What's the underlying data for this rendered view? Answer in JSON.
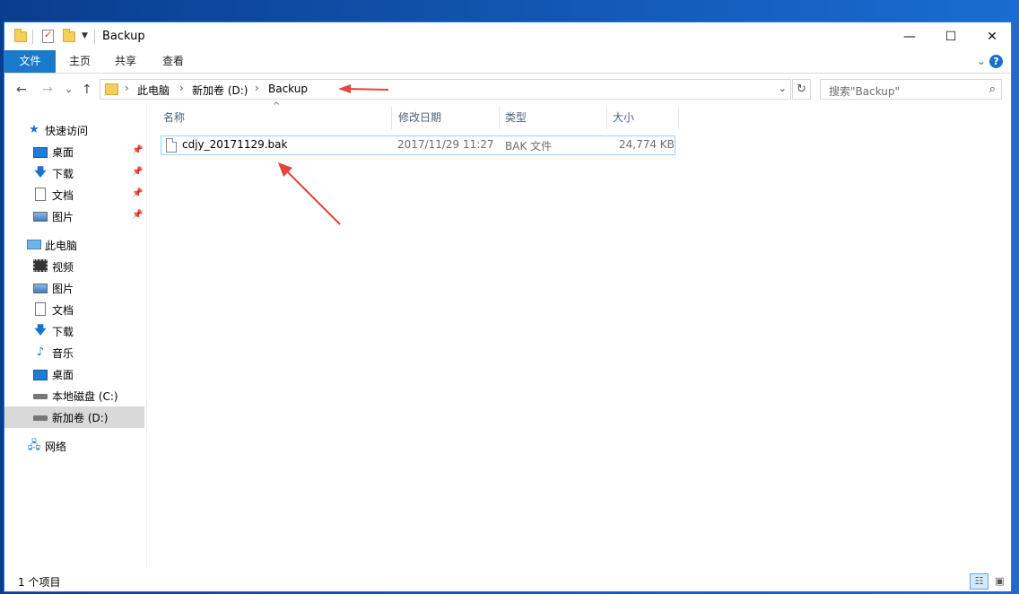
{
  "window": {
    "title": "Backup",
    "minimize_icon": "—",
    "maximize_icon": "☐",
    "close_icon": "✕"
  },
  "ribbon": {
    "tabs": [
      "文件",
      "主页",
      "共享",
      "查看"
    ],
    "collapse_icon": "⌄",
    "help_icon": "?"
  },
  "address": {
    "crumbs": [
      "此电脑",
      "新加卷 (D:)",
      "Backup"
    ],
    "separator": "›",
    "dropdown_icon": "⌄",
    "refresh_icon": "↻"
  },
  "nav": {
    "back": "←",
    "forward": "→",
    "recent": "⌄",
    "up": "↑"
  },
  "search": {
    "placeholder": "搜索\"Backup\"",
    "icon": "⌕"
  },
  "sidebar": {
    "quick_access": "快速访问",
    "quick_items": [
      {
        "label": "桌面",
        "icon": "desktop-icon"
      },
      {
        "label": "下载",
        "icon": "download-icon"
      },
      {
        "label": "文档",
        "icon": "document-icon"
      },
      {
        "label": "图片",
        "icon": "pictures-icon"
      }
    ],
    "pin_icon": "📌",
    "this_pc": "此电脑",
    "pc_items": [
      {
        "label": "视频",
        "icon": "videos-icon"
      },
      {
        "label": "图片",
        "icon": "pictures-icon"
      },
      {
        "label": "文档",
        "icon": "document-icon"
      },
      {
        "label": "下载",
        "icon": "download-icon"
      },
      {
        "label": "音乐",
        "icon": "music-icon"
      },
      {
        "label": "桌面",
        "icon": "desktop-icon"
      },
      {
        "label": "本地磁盘 (C:)",
        "icon": "drive-icon"
      },
      {
        "label": "新加卷 (D:)",
        "icon": "drive-icon",
        "selected": true
      }
    ],
    "network": "网络"
  },
  "columns": {
    "name": "名称",
    "date": "修改日期",
    "type": "类型",
    "size": "大小",
    "sort_indicator": "^"
  },
  "files": [
    {
      "name": "cdjy_20171129.bak",
      "date": "2017/11/29 11:27",
      "type": "BAK 文件",
      "size": "24,774 KB"
    }
  ],
  "status": {
    "item_count": "1 个项目"
  },
  "colors": {
    "accent": "#1979ca",
    "selection_border": "#99d1ff",
    "annotation_arrow": "#e8423a"
  }
}
